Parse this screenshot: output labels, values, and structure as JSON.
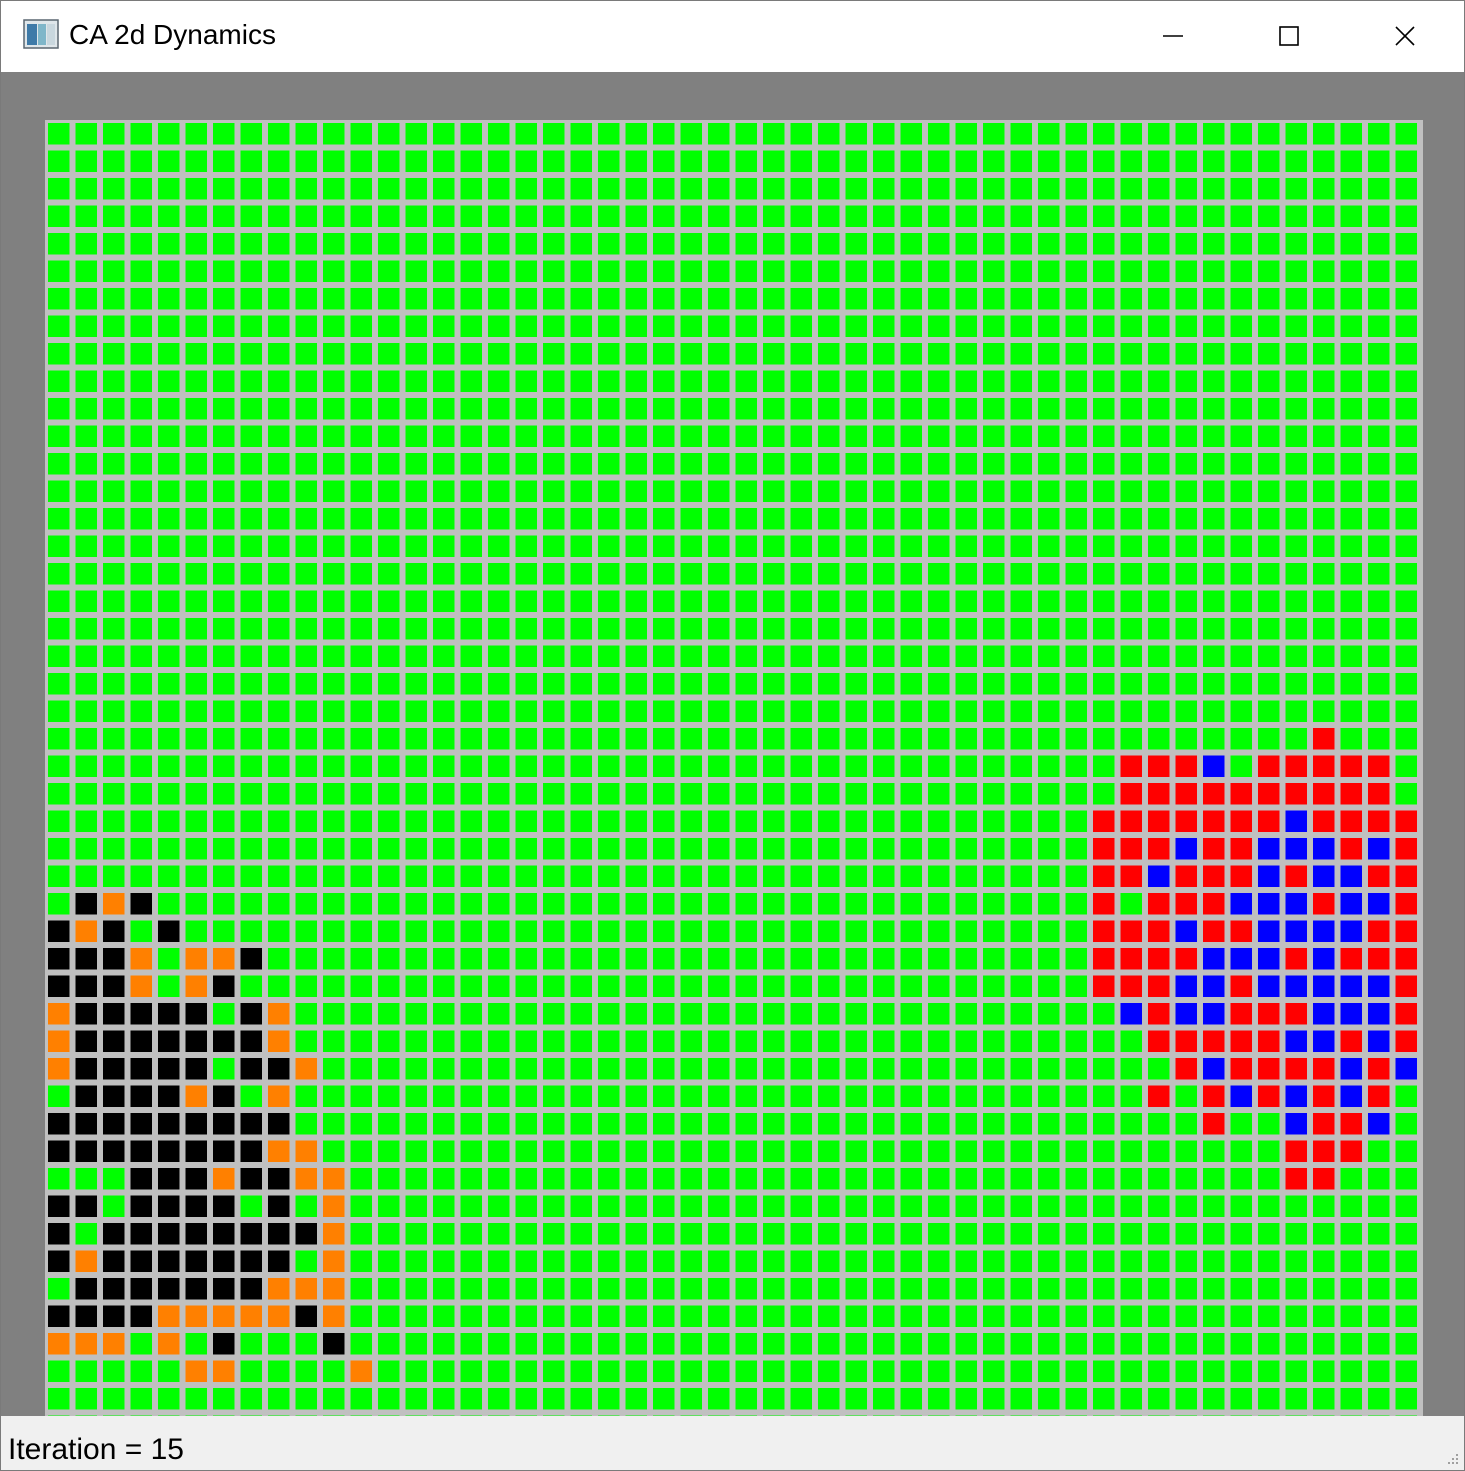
{
  "window": {
    "title": "CA 2d Dynamics",
    "app_icon": "window-app-icon",
    "controls": {
      "minimize_icon": "minimize-icon",
      "maximize_icon": "maximize-icon",
      "close_icon": "close-icon"
    }
  },
  "status": {
    "iteration_text": "Iteration = 15"
  },
  "colors": {
    "client_background": "#808080",
    "gridline": "#c0c0c0",
    "states": {
      "G": "#00ff00",
      "K": "#000000",
      "O": "#ff8000",
      "R": "#ff0000",
      "B": "#0000ff"
    }
  },
  "grid": {
    "rows": 50,
    "cols": 50,
    "default_state": "G",
    "cells": [
      "GGGGGGGGGGGGGGGGGGGGGGGGGGGGGGGGGGGGGGGGGGGGGGGGGG",
      "GGGGGGGGGGGGGGGGGGGGGGGGGGGGGGGGGGGGGGGGGGGGGGGGGG",
      "GGGGGGGGGGGGGGGGGGGGGGGGGGGGGGGGGGGGGGGGGGGGGGGGGG",
      "GGGGGGGGGGGGGGGGGGGGGGGGGGGGGGGGGGGGGGGGGGGGGGGGGG",
      "GGGGGGGGGGGGGGGGGGGGGGGGGGGGGGGGGGGGGGGGGGGGGGGGGG",
      "GGGGGGGGGGGGGGGGGGGGGGGGGGGGGGGGGGGGGGGGGGGGGGGGGG",
      "GGGGGGGGGGGGGGGGGGGGGGGGGGGGGGGGGGGGGGGGGGGGGGGGGG",
      "GGGGGGGGGGGGGGGGGGGGGGGGGGGGGGGGGGGGGGGGGGGGGGGGGG",
      "GGGGGGGGGGGGGGGGGGGGGGGGGGGGGGGGGGGGGGGGGGGGGGGGGG",
      "GGGGGGGGGGGGGGGGGGGGGGGGGGGGGGGGGGGGGGGGGGGGGGGGGG",
      "GGGGGGGGGGGGGGGGGGGGGGGGGGGGGGGGGGGGGGGGGGGGGGGGGG",
      "GGGGGGGGGGGGGGGGGGGGGGGGGGGGGGGGGGGGGGGGGGGGGGGGGG",
      "GGGGGGGGGGGGGGGGGGGGGGGGGGGGGGGGGGGGGGGGGGGGGGGGGG",
      "GGGGGGGGGGGGGGGGGGGGGGGGGGGGGGGGGGGGGGGGGGGGGGGGGG",
      "GGGGGGGGGGGGGGGGGGGGGGGGGGGGGGGGGGGGGGGGGGGGGGGGGG",
      "GGGGGGGGGGGGGGGGGGGGGGGGGGGGGGGGGGGGGGGGGGGGGGGGGG",
      "GGGGGGGGGGGGGGGGGGGGGGGGGGGGGGGGGGGGGGGGGGGGGGGGGG",
      "GGGGGGGGGGGGGGGGGGGGGGGGGGGGGGGGGGGGGGGGGGGGGGGGGG",
      "GGGGGGGGGGGGGGGGGGGGGGGGGGGGGGGGGGGGGGGGGGGGGGGGGG",
      "GGGGGGGGGGGGGGGGGGGGGGGGGGGGGGGGGGGGGGGGGGGGGGGGGG",
      "GGGGGGGGGGGGGGGGGGGGGGGGGGGGGGGGGGGGGGGGGGGGGGGGGG",
      "GGGGGGGGGGGGGGGGGGGGGGGGGGGGGGGGGGGGGGGGGGGGGGGGGG",
      "GGGGGGGGGGGGGGGGGGGGGGGGGGGGGGGGGGGGGGGGGGGGGGRGGGGR",
      "GGGGGGGGGGGGGGGGGGGGGGGGGGGGGGGGGGGGGGGRRRBGRRRRRG",
      "GGGGGGGGGGGGGGGGGGGGGGGGGGGGGGGGGGGGGGGRRRRRRRRRRG",
      "GGGGGGGGGGGGGGGGGGGGGGGGGGGGGGGGGGGGGGRRRRRRRBRRRR",
      "GGGGGGGGGGGGGGGGGGGGGGGGGGGGGGGGGGGGGGRRRBRRBBBRBR",
      "GGGGGGGGGGGGGGGGGGGGGGGGGGGGGGGGGGGGGGRRBRRRBRBBRR",
      "GKOKGGGGGGGGGGGGGGGGGGGGGGGGGGGGGGGGGGRGRRRBBBRBBR",
      "KOKGKGGGGGGGGGGGGGGGGGGGGGGGGGGGGGGGGGRRRBRRBBBBRR",
      "KKKOGOOKGGGGGGGGGGGGGGGGGGGGGGGGGGGGGGRRRRBBBRBRRR",
      "KKKOGOKGGGGGGGGGGGGGGGGGGGGGGGGGGGGGGGRRRBBRBBBBBR",
      "OKKKKKGKOGGGGGGGGGGGGGGGGGGGGGGGGGGGGGGBRBBRRRBBBR",
      "OKKKKKKKOGGGGGGGGGGGGGGGGGGGGGGGGGGGGGGGRRRRRBBRBR",
      "OKKKKKGKKOGGGGGGGGGGGGGGGGGGGGGGGGGGGGGGGRBRRRRBRB",
      "GKKKKOKGOGGGGGGGGGGGGGGGGGGGGGGGGGGGGGGGRGRBRBRBRG",
      "KKKKKKKKKGGGGGGGGGGGGGGGGGGGGGGGGGGGGGGGGGRGGBRRBG",
      "KKKKKKKKOOGGGGGGGGGGGGGGGGGGGGGGGGGGGGGGGGGGGRRRGG",
      "GGGKKKOKKOOGGGGGGGGGGGGGGGGGGGGGGGGGGGGGGGGGGRRGGG",
      "KKGKKKKGKGOGGGGGGGGGGGGGGGGGGGGGGGGGGGGGGGGGGGGGGG",
      "KGKKKKKKKKOGGGGGGGGGGGGGGGGGGGGGGGGGGGGGGGGGGGGGGG",
      "KOKKKKKKKGOGGGGGGGGGGGGGGGGGGGGGGGGGGGGGGGGGGGGGGG",
      "GKKKKKKKOOOGGGGGGGGGGGGGGGGGGGGGGGGGGGGGGGGGGGGGGG",
      "KKKKOOOOOKOGGGGGGGGGGGGGGGGGGGGGGGGGGGGGGGGGGGGGGG",
      "OOOGOGKGGGKGGGGGGGGGGGGGGGGGGGGGGGGGGGGGGGGGGGGGGG",
      "GGGGGOOGGGGOGGGGGGGGGGGGGGGGGGGGGGGGGGGGGGGGGGGGGG",
      "GGGGGGGGGGGGGGGGGGGGGGGGGGGGGGGGGGGGGGGGGGGGGGGGGG",
      "GGGGGGGGGGGGGGGGGGGGGGGGGGGGGGGGGGGGGGGGGGGGGGGGGG",
      "GGGGGGGGGGGGGGGGGGGGGGGGGGGGGGGGGGGGGGGGGGGGGGGGGG",
      "GGGGGGGGGGGGGGGGGGGGGGGGGGGGGGGGGGGGGGGGGGGGGGGGGG"
    ]
  }
}
